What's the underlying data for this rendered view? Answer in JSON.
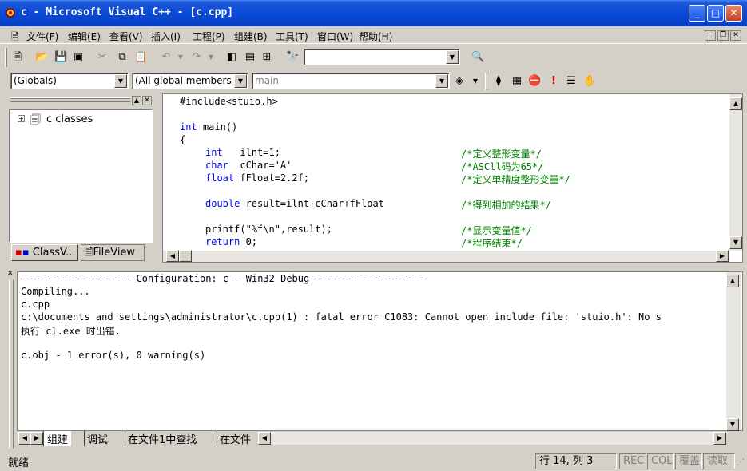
{
  "window": {
    "title": "c - Microsoft Visual C++ - [c.cpp]"
  },
  "menu": [
    "文件(F)",
    "编辑(E)",
    "查看(V)",
    "插入(I)",
    "工程(P)",
    "组建(B)",
    "工具(T)",
    "窗口(W)",
    "帮助(H)"
  ],
  "wizard": {
    "class_combo": "(Globals)",
    "members_combo": "(All global members",
    "function_combo": "main"
  },
  "classview": {
    "tree_root": "c classes",
    "tab_classview": "ClassV...",
    "tab_fileview": "FileView"
  },
  "editor": {
    "lines": [
      {
        "code": "#include<stuio.h>",
        "comment": ""
      },
      {
        "code": "",
        "comment": ""
      },
      {
        "kw": "int",
        "code": " main()",
        "comment": ""
      },
      {
        "code": "{",
        "comment": ""
      },
      {
        "kw": "int",
        "code": "   ilnt=1;",
        "comment": "/*定义整形变量*/",
        "indent": true
      },
      {
        "kw": "char",
        "code": "  cChar='A'",
        "comment": "/*ASCll码为65*/",
        "indent": true
      },
      {
        "kw": "float",
        "code": " fFloat=2.2f;",
        "comment": "/*定义单精度整形变量*/",
        "indent": true
      },
      {
        "code": "",
        "comment": ""
      },
      {
        "kw": "double",
        "code": " result=ilnt+cChar+fFloat",
        "comment": "/*得到相加的结果*/",
        "indent": true
      },
      {
        "code": "",
        "comment": ""
      },
      {
        "code": "printf(\"%f\\n\",result);",
        "comment": "/*显示变量值*/",
        "indent": true
      },
      {
        "kw": "return",
        "code": " 0;",
        "comment": "/*程序结束*/",
        "indent": true
      }
    ]
  },
  "output": {
    "lines": [
      "--------------------Configuration: c - Win32 Debug--------------------",
      "Compiling...",
      "c.cpp",
      "c:\\documents and settings\\administrator\\c.cpp(1) : fatal error C1083: Cannot open include file: 'stuio.h': No s",
      "执行 cl.exe 时出错.",
      "",
      "c.obj - 1 error(s), 0 warning(s)"
    ],
    "tabs": [
      "组建",
      "调试",
      "在文件1中查找",
      "在文件"
    ]
  },
  "status": {
    "left": "就绪",
    "position": "行 14, 列 3",
    "rec": "REC",
    "col": "COL",
    "ovr": "覆盖",
    "read": "读取"
  },
  "colors": {
    "title_blue": "#0a4ad6",
    "keyword": "#0000ff",
    "comment": "#008000"
  }
}
